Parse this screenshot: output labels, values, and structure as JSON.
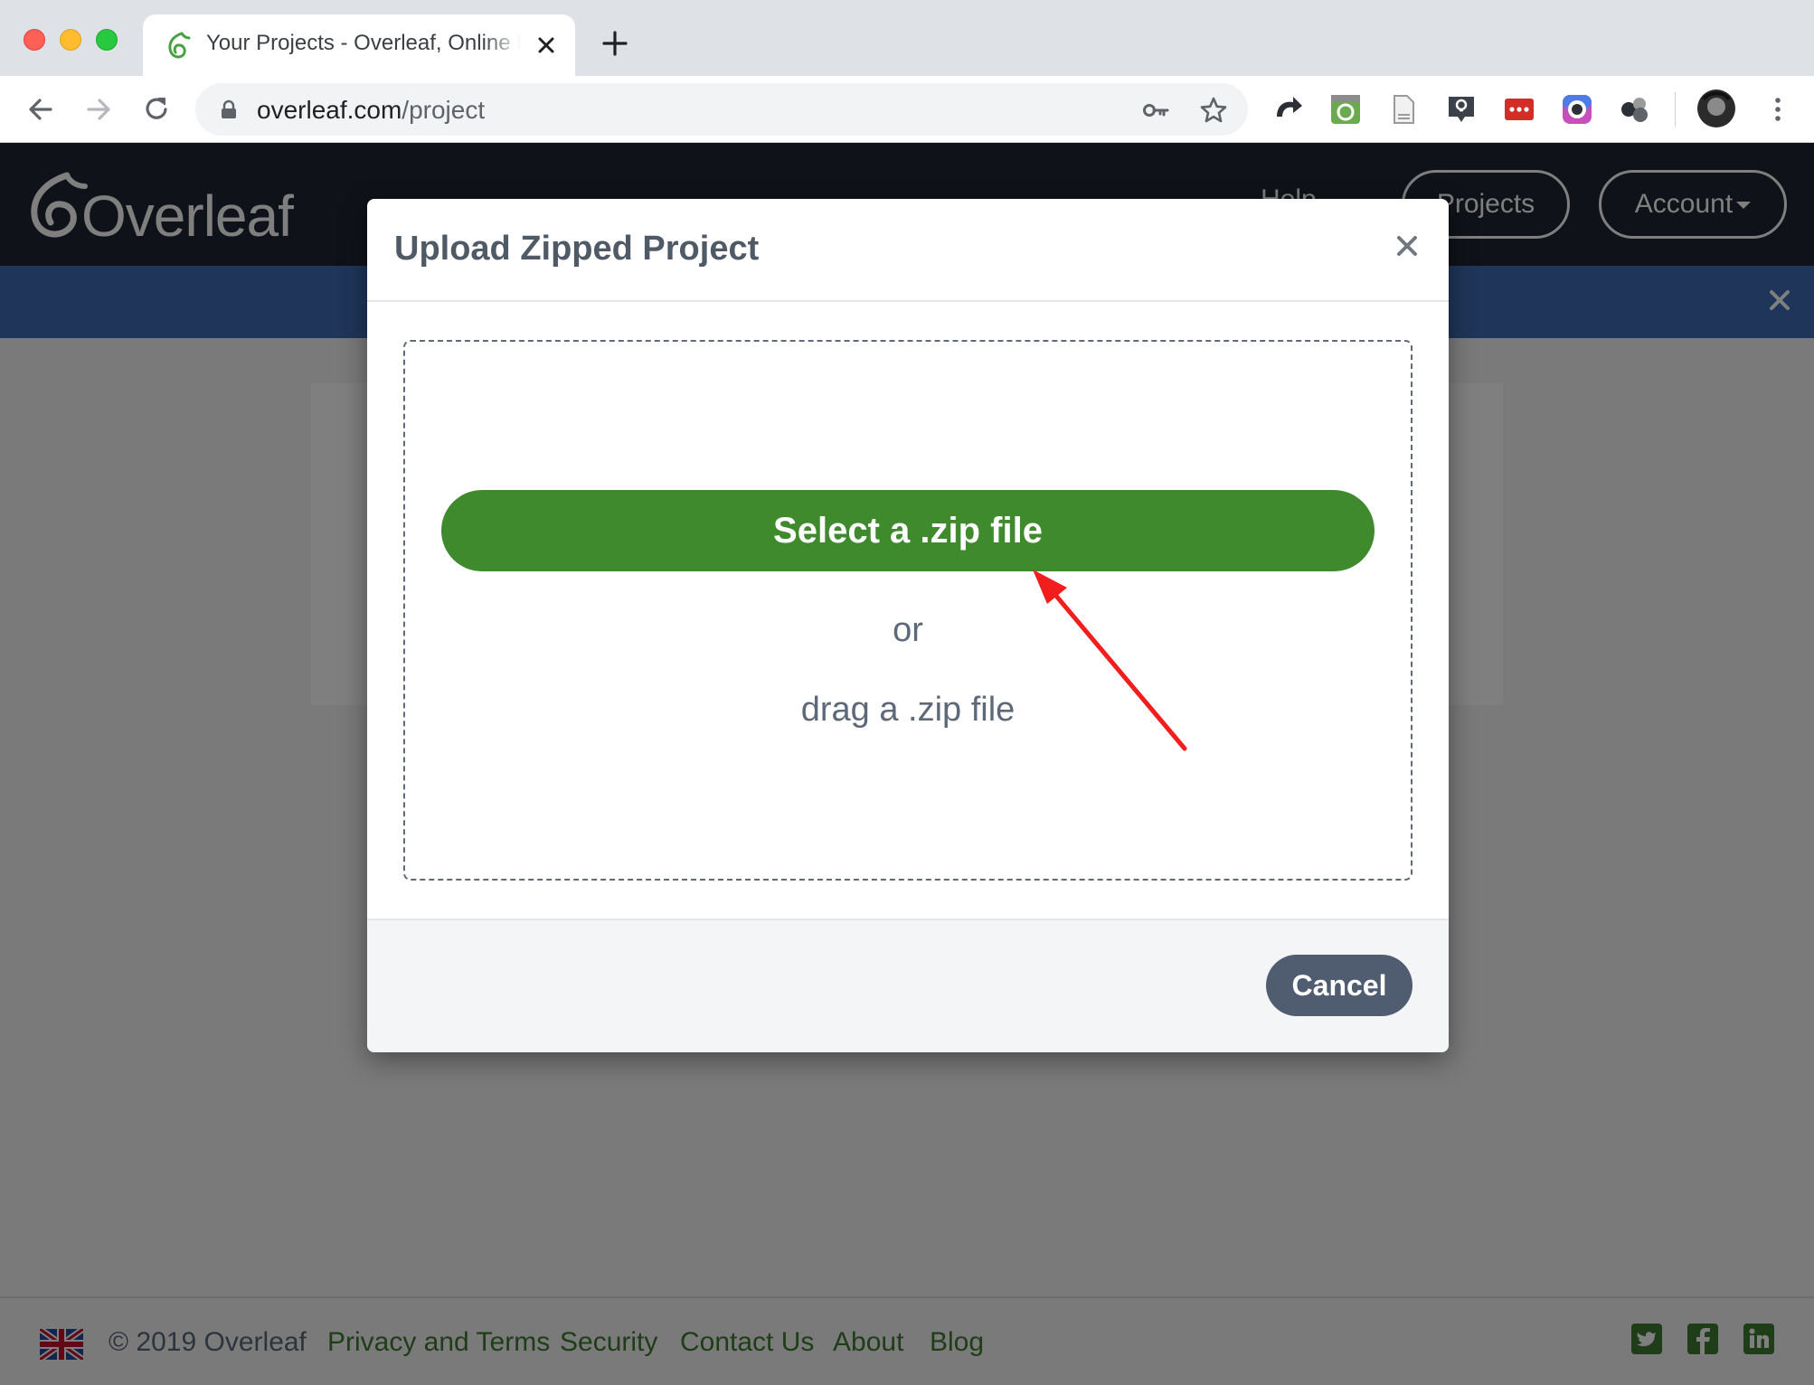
{
  "browser": {
    "tab": {
      "title": "Your Projects - Overleaf, Online LaTeX Editor",
      "favicon": "overleaf-leaf-icon"
    },
    "url": {
      "domain": "overleaf.com",
      "path": "/project"
    },
    "omnibox_icons": [
      "key-icon",
      "star-icon"
    ],
    "extensions": [
      "ext-arrow-icon",
      "ext-refresh-icon",
      "ext-page-icon",
      "ext-lightbulb-icon",
      "ext-lastpass-icon",
      "ext-camera-icon",
      "ext-balls-icon"
    ],
    "colors": {
      "tabbar": "#dee1e6",
      "toolbar": "#ffffff"
    }
  },
  "navbar": {
    "logo_text": "Overleaf",
    "help_label": "Help",
    "projects_label": "Projects",
    "account_label": "Account"
  },
  "modal": {
    "title": "Upload Zipped Project",
    "select_button_label": "Select a .zip file",
    "or_label": "or",
    "drag_label": "drag a .zip file",
    "cancel_label": "Cancel",
    "colors": {
      "primary": "#3f8a2c",
      "cancel": "#505d71"
    }
  },
  "footer": {
    "copyright": "© 2019 Overleaf",
    "links": [
      "Privacy and Terms",
      "Security",
      "Contact Us",
      "About",
      "Blog"
    ],
    "social": [
      "twitter-icon",
      "facebook-icon",
      "linkedin-icon"
    ],
    "link_color": "#3f7a31"
  }
}
